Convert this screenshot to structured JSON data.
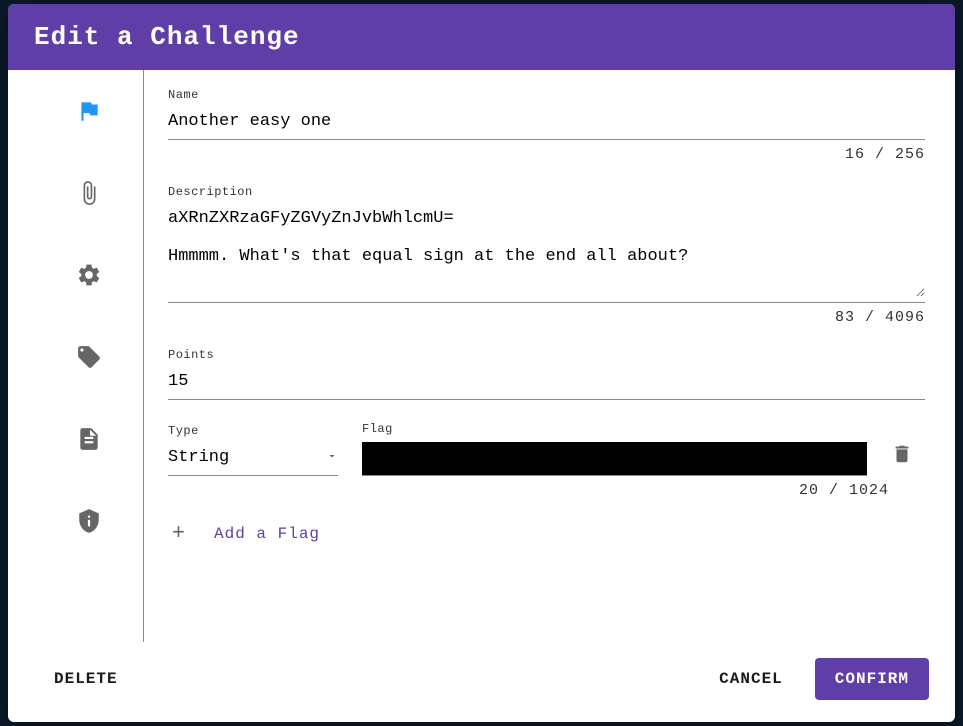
{
  "title": "Edit a Challenge",
  "fields": {
    "name": {
      "label": "Name",
      "value": "Another easy one",
      "counter": "16 / 256"
    },
    "description": {
      "label": "Description",
      "value": "aXRnZXRzaGFyZGVyZnJvbWhlcmU=\n\nHmmmm. What's that equal sign at the end all about?",
      "counter": "83 / 4096"
    },
    "points": {
      "label": "Points",
      "value": "15"
    },
    "flag": {
      "type_label": "Type",
      "type_value": "String",
      "flag_label": "Flag",
      "flag_value": "",
      "counter": "20 / 1024"
    }
  },
  "add_flag_label": "Add a Flag",
  "buttons": {
    "delete": "DELETE",
    "cancel": "CANCEL",
    "confirm": "CONFIRM"
  },
  "colors": {
    "accent": "#5f3ea8",
    "active_icon": "#2196f3"
  }
}
